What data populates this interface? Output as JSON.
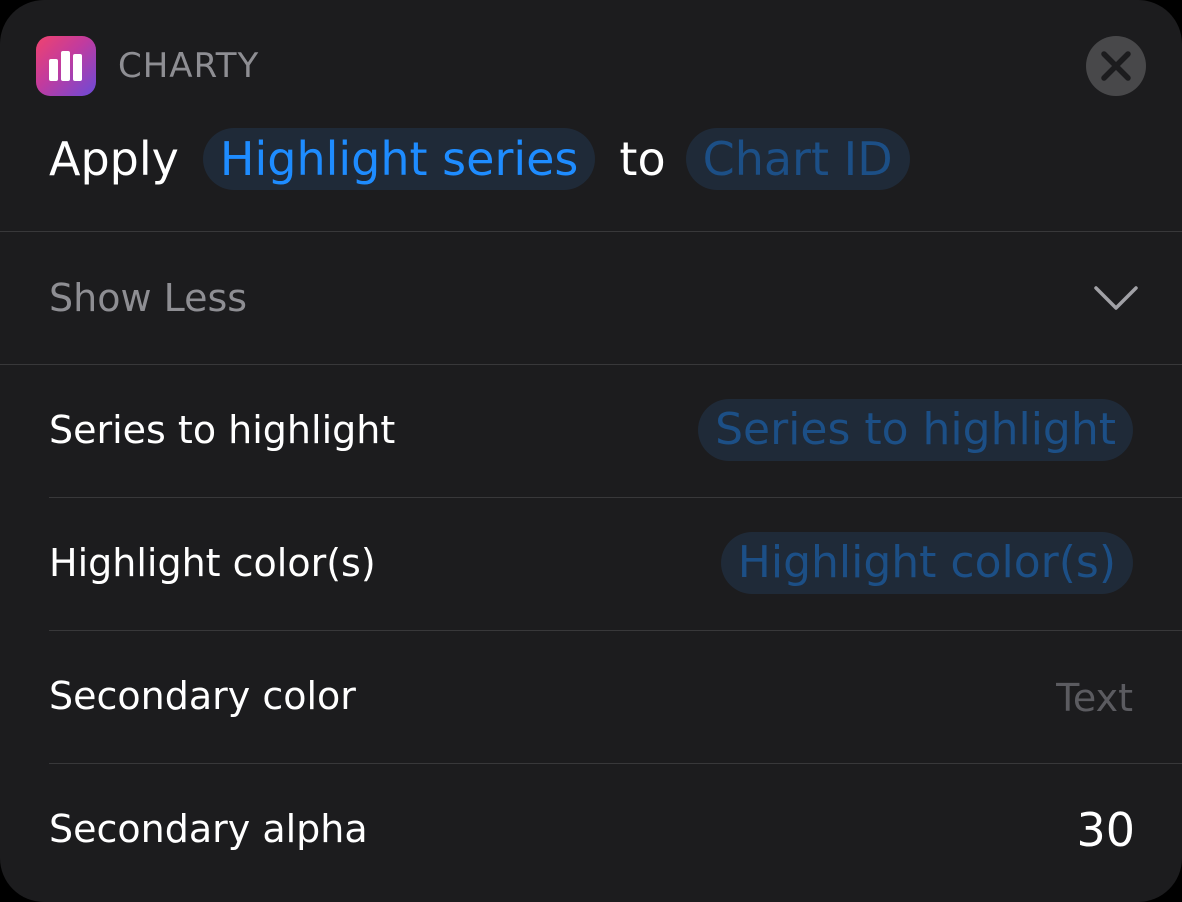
{
  "header": {
    "app_name": "CHARTY",
    "app_icon": "bar-chart-icon",
    "close_icon": "close-icon"
  },
  "action": {
    "prefix": "Apply",
    "action_value": "Highlight series",
    "connector": "to",
    "target_placeholder": "Chart ID"
  },
  "toggle": {
    "label": "Show Less",
    "icon": "chevron-down-icon"
  },
  "params": [
    {
      "label": "Series to highlight",
      "value": "Series to highlight",
      "kind": "variable-pill"
    },
    {
      "label": "Highlight color(s)",
      "value": "Highlight color(s)",
      "kind": "variable-pill"
    },
    {
      "label": "Secondary color",
      "value": "Text",
      "kind": "placeholder"
    },
    {
      "label": "Secondary alpha",
      "value": "30",
      "kind": "value"
    }
  ],
  "colors": {
    "background": "#1c1c1e",
    "accent": "#1e8cff",
    "param_text": "#1c4f86",
    "pill_bg": "#1f2a38",
    "secondary_text": "#8e8e93"
  }
}
